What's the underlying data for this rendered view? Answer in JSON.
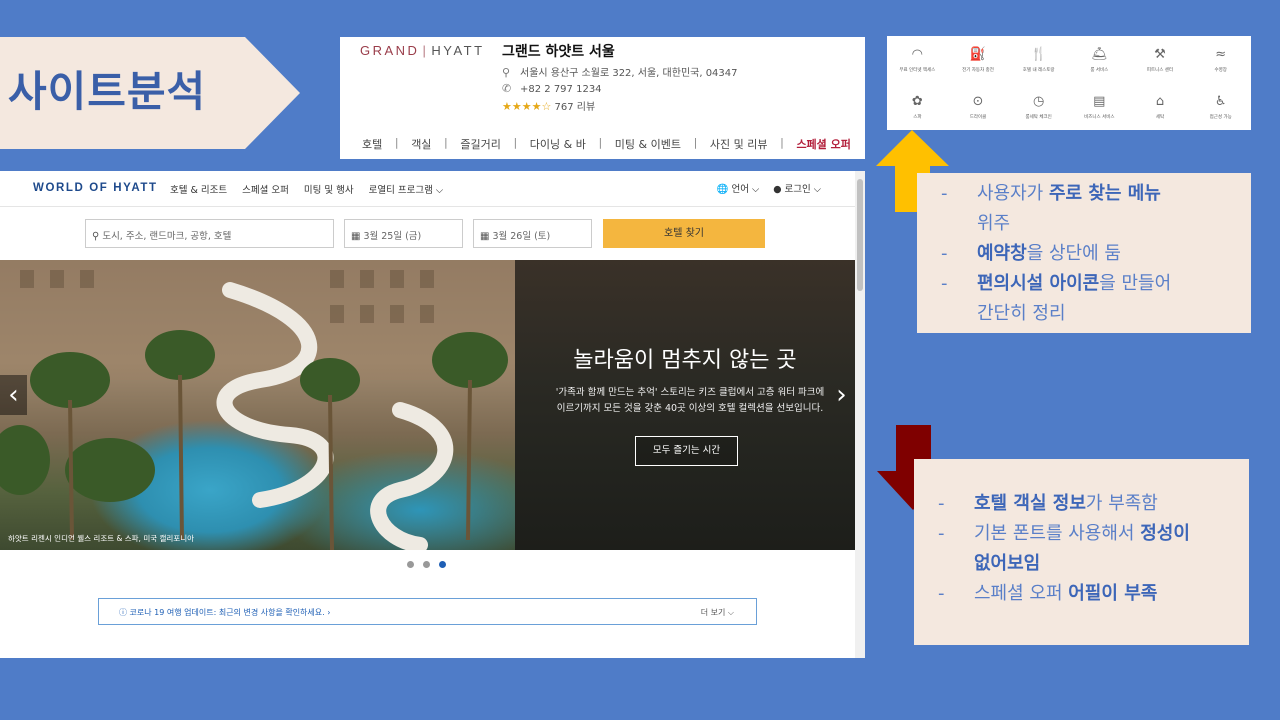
{
  "slide": {
    "title": "사이트분석",
    "colors": {
      "background": "#4f7cc8",
      "title_arrow": "#f4e8df",
      "up_arrow": "#ffc000",
      "down_arrow": "#7f0000"
    }
  },
  "hotel_card": {
    "logo_grand": "GRAND",
    "logo_hyatt": "HYATT",
    "name": "그랜드 하얏트 서울",
    "address": "서울시 용산구 소월로 322, 서울, 대한민국, 04347",
    "phone": "+82 2 797 1234",
    "stars": "★★★★☆",
    "reviews": "767 리뷰",
    "nav": [
      "호텔",
      "객실",
      "즐길거리",
      "다이닝 & 바",
      "미팅 & 이벤트",
      "사진 및 리뷰",
      "스페셜 오퍼"
    ]
  },
  "amenities": [
    {
      "icon": "wifi-icon",
      "glyph": "◠",
      "label": "무료 인터넷 액세스"
    },
    {
      "icon": "ev-charger-icon",
      "glyph": "⛽",
      "label": "전기 자동차 충전"
    },
    {
      "icon": "restaurant-icon",
      "glyph": "🍴",
      "label": "호텔 내 레스토랑"
    },
    {
      "icon": "room-service-icon",
      "glyph": "🛎",
      "label": "룸 서비스"
    },
    {
      "icon": "fitness-icon",
      "glyph": "⚒",
      "label": "피트니스 센터"
    },
    {
      "icon": "pool-icon",
      "glyph": "≈",
      "label": "수영장"
    },
    {
      "icon": "spa-icon",
      "glyph": "✿",
      "label": "스파"
    },
    {
      "icon": "valet-icon",
      "glyph": "⊙",
      "label": "드라이클"
    },
    {
      "icon": "concierge-icon",
      "glyph": "◷",
      "label": "룸세탁 체크인"
    },
    {
      "icon": "business-icon",
      "glyph": "▤",
      "label": "비즈니스 서비스"
    },
    {
      "icon": "laundry-icon",
      "glyph": "⌂",
      "label": "세탁"
    },
    {
      "icon": "accessible-icon",
      "glyph": "♿",
      "label": "접근성 가능"
    }
  ],
  "browser": {
    "logo": "WORLD OF HYATT",
    "nav_links": [
      "호텔 & 리조트",
      "스페셜 오퍼",
      "미팅 및 행사",
      "로열티 프로그램"
    ],
    "language": "언어",
    "login": "로그인",
    "search": {
      "placeholder": "도시, 주소, 랜드마크, 공항, 호텔",
      "checkin": "3월 25일 (금)",
      "checkout": "3월 26일 (토)",
      "button": "호텔 찾기"
    },
    "hero": {
      "title": "놀라움이 멈추지 않는 곳",
      "desc_line1": "'가족과 함께 만드는 추억' 스토리는 키즈 클럽에서 고층 워터 파크에",
      "desc_line2": "이르기까지 모든 것을 갖춘 40곳 이상의 호텔 컬렉션을 선보입니다.",
      "button": "모두 즐기는 시간",
      "caption": "하얏트 리젠시 인디언 웰스 리조트 & 스파, 미국 캘리포니아"
    },
    "carousel_dots": 3,
    "carousel_active": 3,
    "covid": {
      "text": "코로나 19 여행 업데이트: 최근의 변경 사항을 확인하세요.",
      "more": "더 보기"
    }
  },
  "notes_top": [
    {
      "bold": "",
      "pre": "사용자가 ",
      "b": "주로 찾는 메뉴",
      "post": ""
    },
    {
      "pre": "위주",
      "b": "",
      "post": ""
    },
    {
      "pre": "",
      "b": "예약창",
      "post": "을 상단에 둠"
    },
    {
      "pre": "",
      "b": "편의시설 아이콘",
      "post": "을 만들어"
    },
    {
      "pre": "간단히 정리",
      "b": "",
      "post": ""
    }
  ],
  "notes_bottom": [
    {
      "pre": "",
      "b": "호텔 객실 정보",
      "post": "가 부족함"
    },
    {
      "pre": "기본 폰트를 사용해서 ",
      "b": "정성이",
      "post": ""
    },
    {
      "pre": "",
      "b": "없어보임",
      "post": ""
    },
    {
      "pre": "스페셜 오퍼 ",
      "b": "어필이 부족",
      "post": ""
    }
  ]
}
